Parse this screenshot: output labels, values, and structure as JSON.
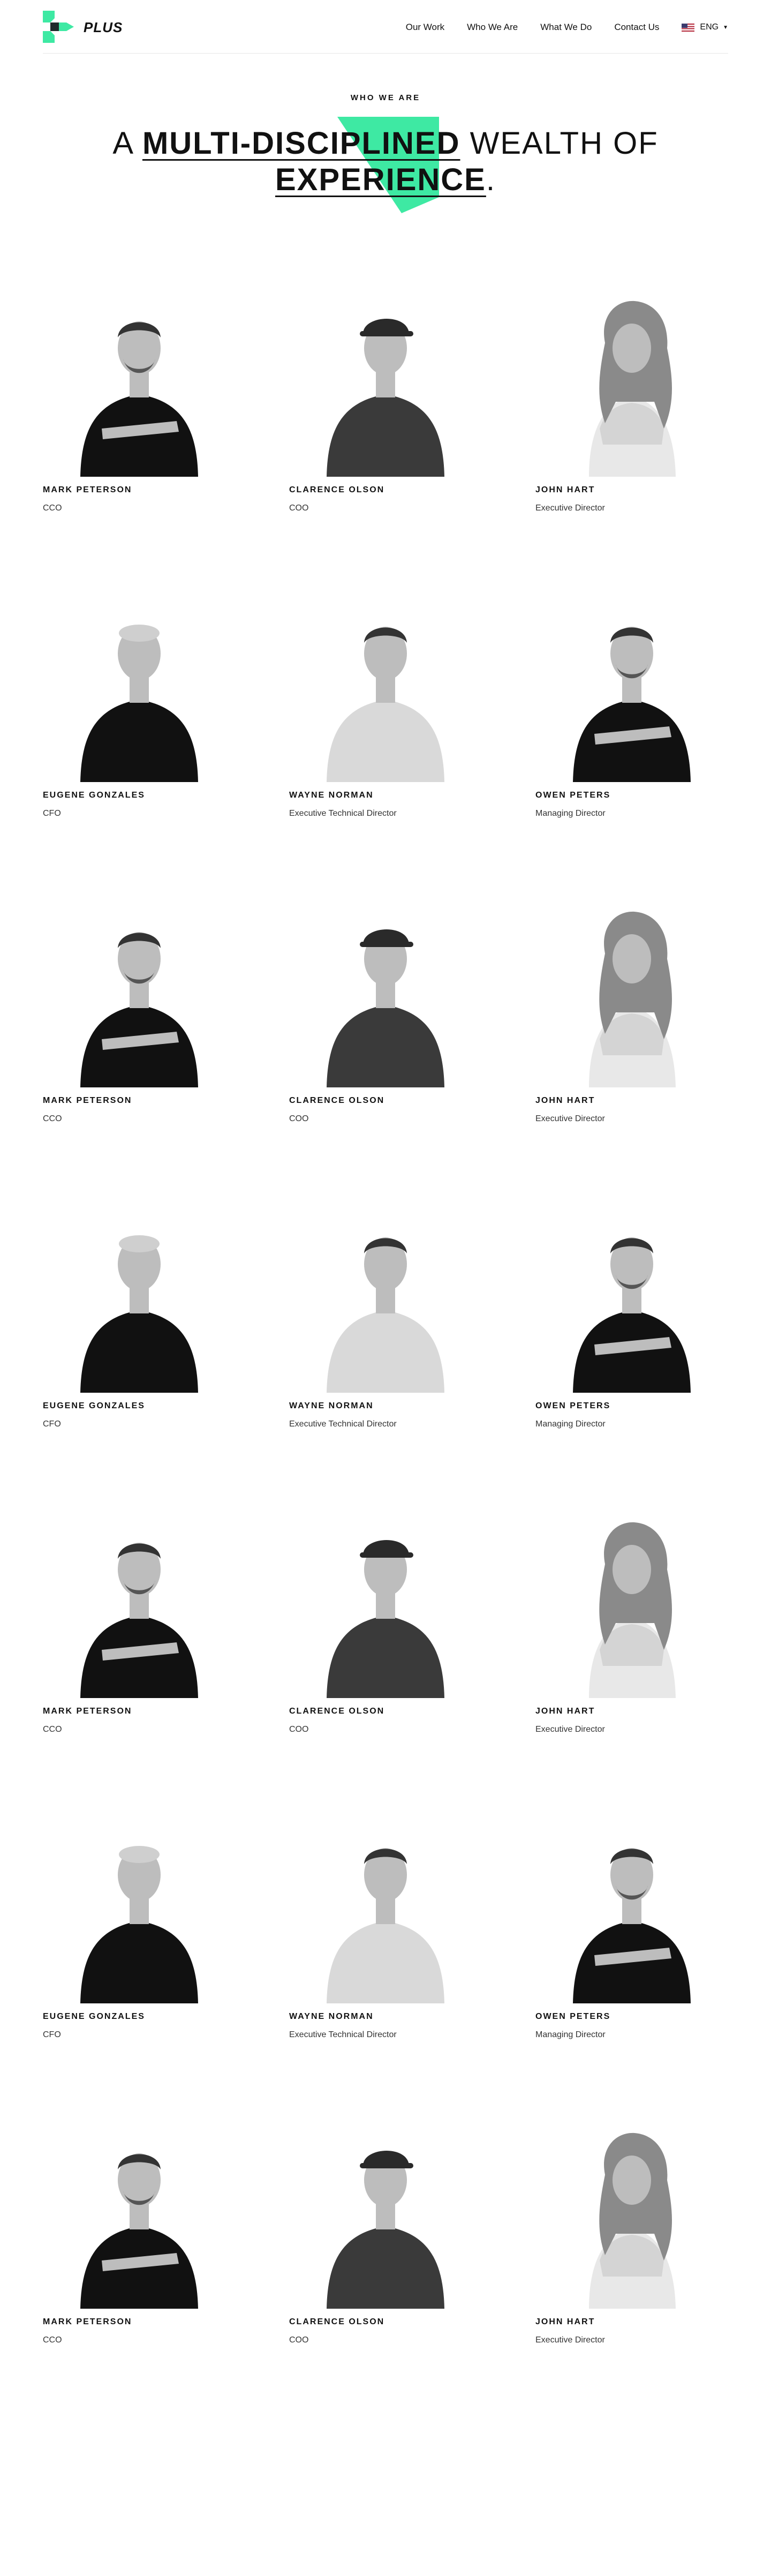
{
  "brand": {
    "name": "PLUS",
    "accent_color": "#3ee9a3"
  },
  "nav": {
    "items": [
      {
        "label": "Our Work"
      },
      {
        "label": "Who We Are"
      },
      {
        "label": "Contact Us"
      }
    ],
    "what_we_do": "What We Do",
    "language": "ENG"
  },
  "hero": {
    "eyebrow": "WHO WE ARE",
    "line1_pre": "A ",
    "line1_bold": "MULTI-DISCIPLINED",
    "line1_post": " WEALTH OF",
    "line2_bold": "EXPERIENCE",
    "line2_post": "."
  },
  "team": [
    {
      "name": "MARK PETERSON",
      "role": "CCO"
    },
    {
      "name": "CLARENCE OLSON",
      "role": "COO"
    },
    {
      "name": "JOHN HART",
      "role": "Executive Director"
    },
    {
      "name": "EUGENE GONZALES",
      "role": "CFO"
    },
    {
      "name": "WAYNE NORMAN",
      "role": "Executive Technical Director"
    },
    {
      "name": "OWEN PETERS",
      "role": "Managing Director"
    },
    {
      "name": "MARK PETERSON",
      "role": "CCO"
    },
    {
      "name": "CLARENCE OLSON",
      "role": "COO"
    },
    {
      "name": "JOHN HART",
      "role": "Executive Director"
    },
    {
      "name": "EUGENE GONZALES",
      "role": "CFO"
    },
    {
      "name": "WAYNE NORMAN",
      "role": "Executive Technical Director"
    },
    {
      "name": "OWEN PETERS",
      "role": "Managing Director"
    },
    {
      "name": "MARK PETERSON",
      "role": "CCO"
    },
    {
      "name": "CLARENCE OLSON",
      "role": "COO"
    },
    {
      "name": "JOHN HART",
      "role": "Executive Director"
    },
    {
      "name": "EUGENE GONZALES",
      "role": "CFO"
    },
    {
      "name": "WAYNE NORMAN",
      "role": "Executive Technical Director"
    },
    {
      "name": "OWEN PETERS",
      "role": "Managing Director"
    },
    {
      "name": "MARK PETERSON",
      "role": "CCO"
    },
    {
      "name": "CLARENCE OLSON",
      "role": "COO"
    },
    {
      "name": "JOHN HART",
      "role": "Executive Director"
    }
  ]
}
